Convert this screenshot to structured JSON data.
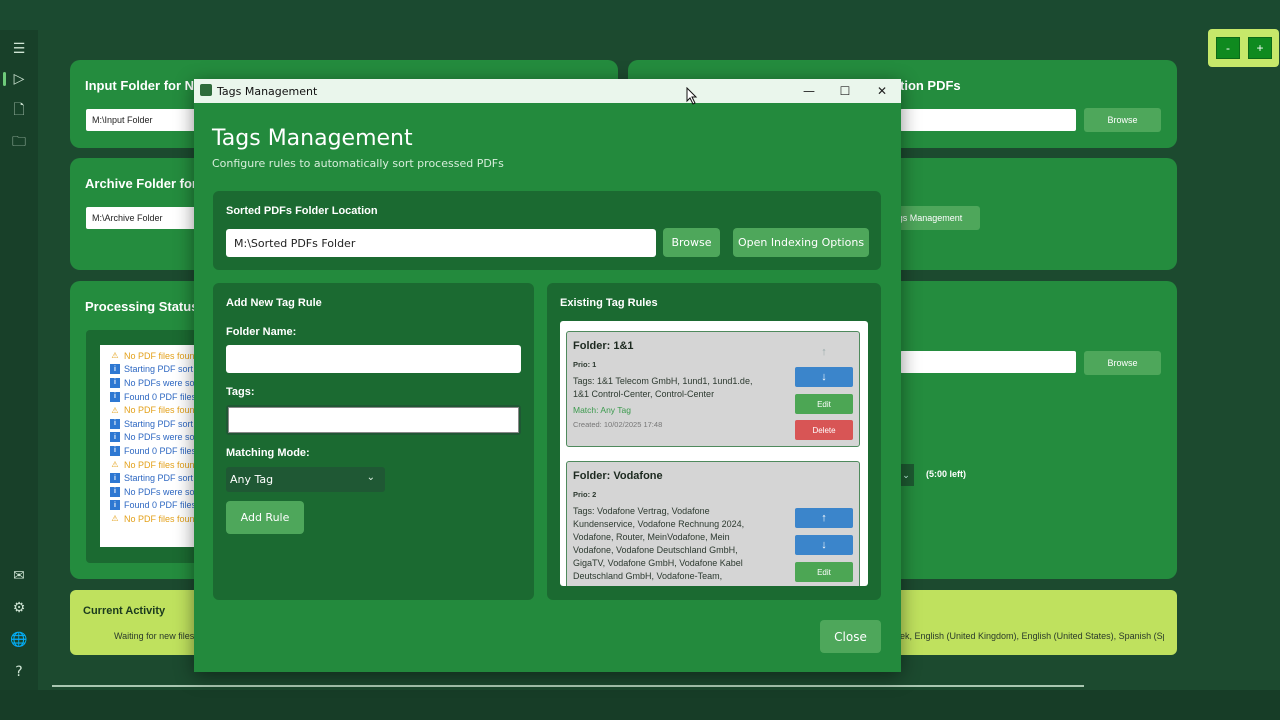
{
  "sidebar": {
    "icons": [
      "menu-icon",
      "play-icon",
      "document-icon",
      "folder-icon",
      "mail-icon",
      "gear-icon",
      "globe-icon",
      "help-icon"
    ],
    "glyphs": {
      "menu": "☰",
      "play": "▷",
      "document": "🗋",
      "folder": "🗀",
      "mail": "✉",
      "gear": "⚙",
      "globe": "🌐",
      "help": "?"
    }
  },
  "zoom": {
    "minus": "-",
    "plus": "+"
  },
  "background": {
    "input_card_title": "Input Folder for N",
    "input_path": "M:\\Input Folder",
    "right_card_title": "tion PDFs",
    "browse_label": "Browse",
    "archive_card_title": "Archive Folder for",
    "archive_path": "M:\\Archive Folder",
    "tags_mgmt_btn": "gs Management",
    "processing_title": "Processing Status",
    "timer_text": "(5:00 left)",
    "log": [
      {
        "type": "warn",
        "text": "No PDF files foun"
      },
      {
        "type": "info",
        "text": "Starting PDF sort"
      },
      {
        "type": "info",
        "text": "No PDFs were so"
      },
      {
        "type": "info",
        "text": "Found 0 PDF files"
      },
      {
        "type": "warn",
        "text": "No PDF files foun"
      },
      {
        "type": "info",
        "text": "Starting PDF sort"
      },
      {
        "type": "info",
        "text": "No PDFs were so"
      },
      {
        "type": "info",
        "text": "Found 0 PDF files"
      },
      {
        "type": "warn",
        "text": "No PDF files foun"
      },
      {
        "type": "info",
        "text": "Starting PDF sort"
      },
      {
        "type": "info",
        "text": "No PDFs were so"
      },
      {
        "type": "info",
        "text": "Found 0 PDF files"
      },
      {
        "type": "warn",
        "text": "No PDF files foun"
      }
    ],
    "activity_title": "Current Activity",
    "activity_text": "Waiting for new files",
    "languages_text": "ek, English (United Kingdom), English (United States), Spanish (Spai"
  },
  "dialog": {
    "window_title": "Tags Management",
    "controls": {
      "minimize": "—",
      "maximize": "☐",
      "close": "✕"
    },
    "heading": "Tags Management",
    "subtitle": "Configure rules to automatically sort processed PDFs",
    "sorted_section": {
      "title": "Sorted PDFs Folder Location",
      "path": "M:\\Sorted PDFs Folder",
      "browse": "Browse",
      "indexing": "Open Indexing Options"
    },
    "add_rule": {
      "title": "Add New Tag Rule",
      "folder_label": "Folder Name:",
      "folder_value": "",
      "tags_label": "Tags:",
      "tags_value": "",
      "mode_label": "Matching Mode:",
      "mode_value": "Any Tag",
      "add_button": "Add Rule"
    },
    "existing": {
      "title": "Existing Tag Rules",
      "rules": [
        {
          "folder": "Folder: 1&1",
          "prio": "Prio: 1",
          "tags_line1": "Tags: 1&1 Telecom GmbH, 1und1, 1und1.de,",
          "tags_line2": "1&1 Control-Center, Control-Center",
          "match": "Match: Any Tag",
          "created": "Created: 10/02/2025 17:48",
          "up": "↑",
          "down": "↓",
          "edit": "Edit",
          "delete": "Delete"
        },
        {
          "folder": "Folder: Vodafone",
          "prio": "Prio: 2",
          "tags_line1": "Tags: Vodafone Vertrag, Vodafone",
          "tags_line2": "Kundenservice, Vodafone Rechnung 2024,",
          "tags_line3": "Vodafone, Router, MeinVodafone, Mein",
          "tags_line4": "Vodafone, Vodafone Deutschland GmbH,",
          "tags_line5": "GigaTV, Vodafone GmbH, Vodafone Kabel",
          "tags_line6": "Deutschland GmbH, Vodafone-Team,",
          "up": "↑",
          "down": "↓",
          "edit": "Edit"
        }
      ]
    },
    "close_button": "Close"
  }
}
